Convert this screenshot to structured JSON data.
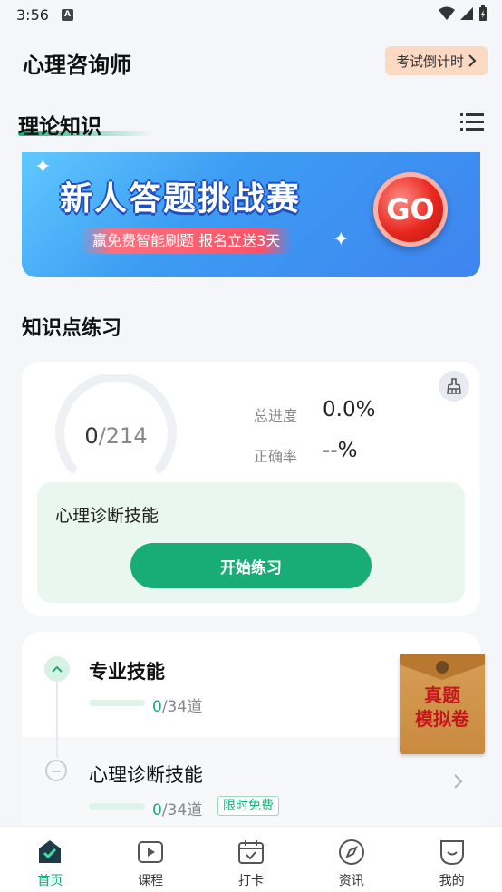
{
  "status_bar": {
    "time": "3:56",
    "notification_badge": "A"
  },
  "header": {
    "app_title": "心理咨询师",
    "countdown_label": "考试倒计时"
  },
  "section": {
    "title": "理论知识"
  },
  "banner": {
    "title": "新人答题挑战赛",
    "subtitle": "赢免费智能刷题  报名立送3天",
    "go_label": "GO"
  },
  "knowledge_practice": {
    "title": "知识点练习",
    "done_count": "0",
    "total_count": "/214",
    "progress_label": "总进度",
    "progress_value": "0.0%",
    "accuracy_label": "正确率",
    "accuracy_value": "--%",
    "current_subject": "心理诊断技能",
    "start_button": "开始练习"
  },
  "chapters": [
    {
      "name": "专业技能",
      "done": "0",
      "total": "/34道",
      "expanded": true
    },
    {
      "name": "心理诊断技能",
      "done": "0",
      "total": "/34道",
      "tag": "限时免费"
    }
  ],
  "envelope": {
    "line1": "真题",
    "line2": "模拟卷"
  },
  "tab_bar": {
    "items": [
      {
        "label": "首页",
        "icon": "home-icon",
        "active": true
      },
      {
        "label": "课程",
        "icon": "video-icon"
      },
      {
        "label": "打卡",
        "icon": "calendar-check-icon"
      },
      {
        "label": "资讯",
        "icon": "compass-icon"
      },
      {
        "label": "我的",
        "icon": "profile-icon"
      }
    ]
  },
  "colors": {
    "accent": "#18ad77",
    "countdown_bg": "#fcd9c2",
    "banner_blue": "#3f84f0"
  }
}
